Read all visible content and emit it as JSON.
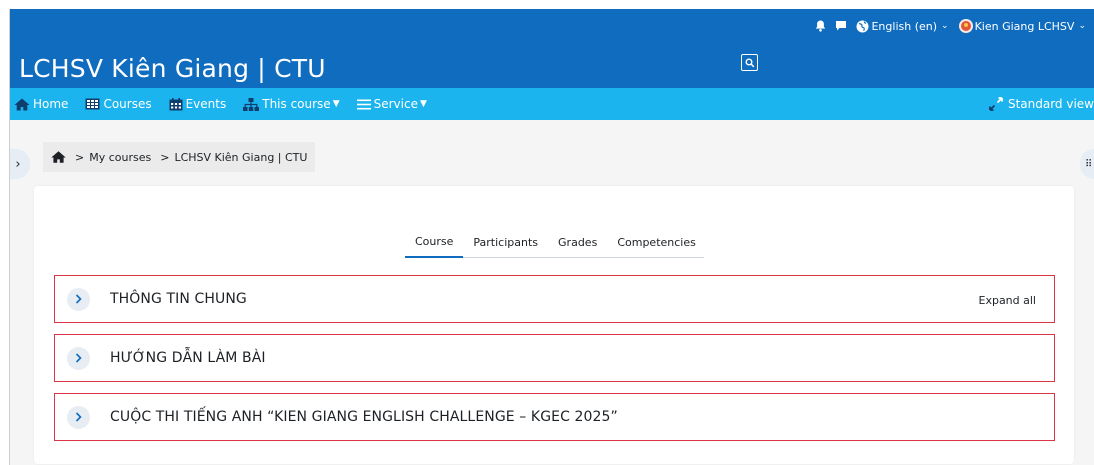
{
  "topbar": {
    "language": "English (en)",
    "user_name": "Kien Giang LCHSV",
    "site_title": "LCHSV Kiên Giang | CTU",
    "colors": {
      "primary": "#0f6cbf",
      "nav": "#1bb4ee"
    }
  },
  "nav": {
    "home": "Home",
    "courses": "Courses",
    "events": "Events",
    "this_course": "This course",
    "service": "Service",
    "standard_view": "Standard view"
  },
  "breadcrumb": {
    "my_courses": "My courses",
    "course": "LCHSV Kiên Giang | CTU"
  },
  "tabs": [
    {
      "label": "Course",
      "active": true
    },
    {
      "label": "Participants"
    },
    {
      "label": "Grades"
    },
    {
      "label": "Competencies"
    }
  ],
  "sections": {
    "expand_all": "Expand all",
    "items": [
      {
        "title": "THÔNG TIN CHUNG"
      },
      {
        "title": "HƯỚNG DẪN LÀM BÀI"
      },
      {
        "title": "CUỘC THI TIẾNG ANH “KIEN GIANG ENGLISH CHALLENGE – KGEC 2025”"
      }
    ]
  },
  "icons": [
    "bell-icon",
    "chat-icon",
    "globe-icon",
    "search-icon",
    "home-icon",
    "calendar-icon",
    "sitemap-icon",
    "menu-icon",
    "expand-arrows-icon",
    "chevron-right-icon"
  ]
}
